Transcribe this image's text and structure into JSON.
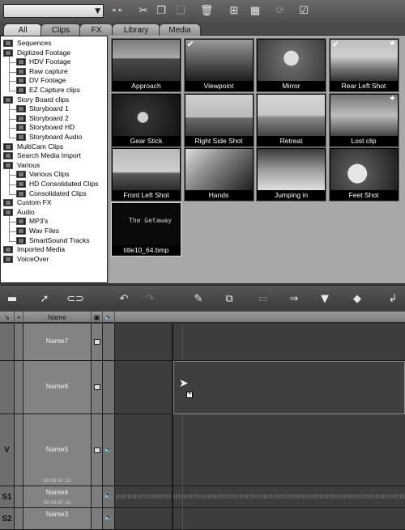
{
  "toolbar": {
    "combo_value": "",
    "icons": [
      "binoculars-icon",
      "scissors-icon",
      "copy-icon",
      "paste-icon",
      "trash-icon",
      "grid-large-icon",
      "grid-small-icon",
      "refresh-icon",
      "checkbox-icon"
    ]
  },
  "tabs": [
    {
      "label": "All",
      "active": true
    },
    {
      "label": "Clips",
      "active": false
    },
    {
      "label": "FX",
      "active": false
    },
    {
      "label": "Library",
      "active": false
    },
    {
      "label": "Media",
      "active": false
    }
  ],
  "tree": {
    "items": [
      {
        "label": "Sequences",
        "level": 0
      },
      {
        "label": "Digitized Footage",
        "level": 0
      },
      {
        "label": "HDV Footage",
        "level": 1
      },
      {
        "label": "Raw capture",
        "level": 1
      },
      {
        "label": "DV Footage",
        "level": 1
      },
      {
        "label": "EZ Capture clips",
        "level": 1
      },
      {
        "label": "Story Board clips",
        "level": 0
      },
      {
        "label": "Storyboard 1",
        "level": 1
      },
      {
        "label": "Storyboard 2",
        "level": 1
      },
      {
        "label": "Storyboard HD",
        "level": 1
      },
      {
        "label": "Storyboard Audio",
        "level": 1
      },
      {
        "label": "MultiCam Clips",
        "level": 0
      },
      {
        "label": "Search Media Import",
        "level": 0
      },
      {
        "label": "Various",
        "level": 0
      },
      {
        "label": "Various Clips",
        "level": 1
      },
      {
        "label": "HD Consolidated Clips",
        "level": 1
      },
      {
        "label": "Consolidated Clips",
        "level": 1
      },
      {
        "label": "Custom FX",
        "level": 0
      },
      {
        "label": "Audio",
        "level": 0
      },
      {
        "label": "MP3's",
        "level": 1
      },
      {
        "label": "Wav Files",
        "level": 1
      },
      {
        "label": "SmartSound Tracks",
        "level": 1
      },
      {
        "label": "Imported Media",
        "level": 0
      },
      {
        "label": "VoiceOver",
        "level": 0
      }
    ]
  },
  "clips": [
    {
      "label": "Approach",
      "checked": false,
      "starred": false
    },
    {
      "label": "Viewpoint",
      "checked": true,
      "starred": false
    },
    {
      "label": "Mirror",
      "checked": false,
      "starred": false
    },
    {
      "label": "Rear Left Shot",
      "checked": true,
      "starred": true
    },
    {
      "label": "Gear Stick",
      "checked": false,
      "starred": false
    },
    {
      "label": "Right Side Shot",
      "checked": false,
      "starred": false
    },
    {
      "label": "Retreat",
      "checked": false,
      "starred": false
    },
    {
      "label": "Lost clip",
      "checked": false,
      "starred": true
    },
    {
      "label": "Front Left Shot",
      "checked": false,
      "starred": false
    },
    {
      "label": "Hands",
      "checked": false,
      "starred": false
    },
    {
      "label": "Jumping in",
      "checked": false,
      "starred": false
    },
    {
      "label": "Feet Shot",
      "checked": false,
      "starred": false
    },
    {
      "label": "title10_64.bmp",
      "checked": false,
      "starred": false,
      "image_text": "The Getaway"
    }
  ],
  "timeline_toolbar": {
    "icons": [
      "folder-icon",
      "pointer-icon",
      "link-icon",
      "undo-icon",
      "redo-icon",
      "razor-icon",
      "clip-transfer-icon",
      "filmstrip-icon",
      "arrow-right-icon",
      "marker-down-icon",
      "split-marker-icon",
      "return-icon"
    ]
  },
  "timeline": {
    "header_name": "Name",
    "tracks": [
      {
        "label": "",
        "name": "Name7",
        "duration": "",
        "audio_icon": false
      },
      {
        "label": "",
        "name": "Name6",
        "duration": "",
        "audio_icon": false
      },
      {
        "label": "V",
        "name": "Name5",
        "duration": "00:09:47.10",
        "audio_icon": true
      },
      {
        "label": "S1",
        "name": "Name4",
        "duration": "00:09:47.10",
        "audio_icon": true
      },
      {
        "label": "S2",
        "name": "Name3",
        "duration": "",
        "audio_icon": true
      }
    ]
  },
  "colors": {
    "accent": "#ffffff",
    "tree_bg": "#ffffff",
    "grid_bg": "#a8a8a8",
    "timeline_bg": "#3b3b3b"
  }
}
